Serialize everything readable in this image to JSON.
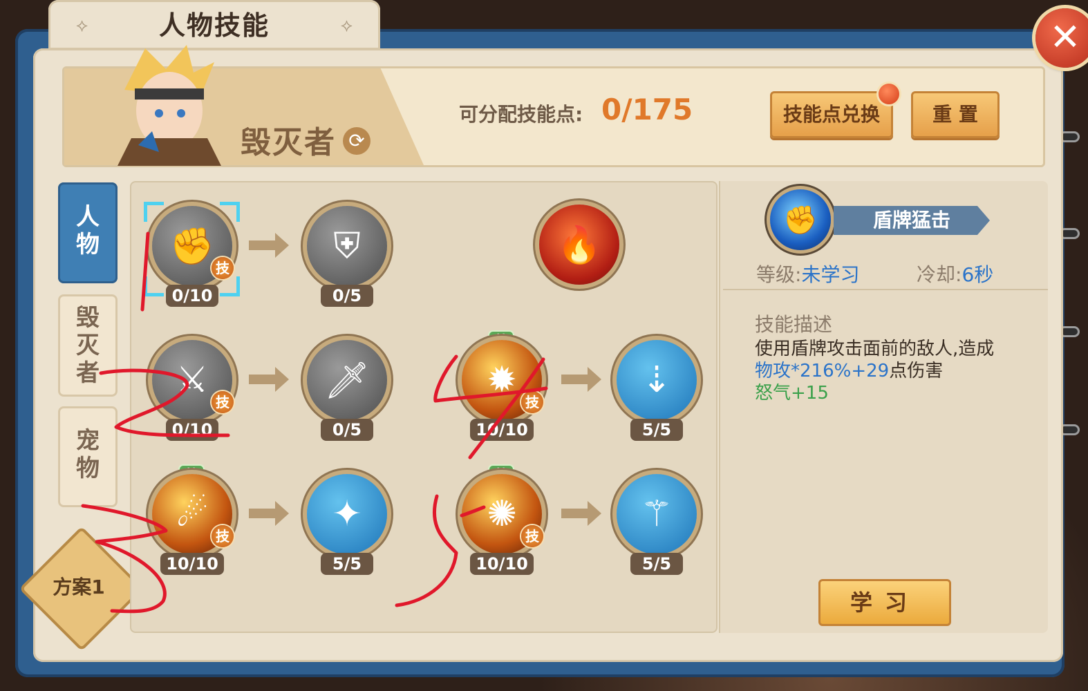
{
  "window": {
    "title": "人物技能"
  },
  "banner": {
    "class_name": "毁灭者",
    "points_label": "可分配技能点:",
    "points_value": "0/175",
    "exchange_button": "技能点兑换",
    "reset_button": "重  置"
  },
  "side_tabs": [
    {
      "label": [
        "人",
        "物"
      ],
      "active": true
    },
    {
      "label": [
        "毁",
        "灭",
        "者"
      ],
      "active": false
    },
    {
      "label": [
        "宠",
        "物"
      ],
      "active": false
    }
  ],
  "plan_badge": "方案1",
  "skill_tree": {
    "rows": [
      {
        "nodes": [
          {
            "icon": "fist-icon",
            "style": "gray",
            "level": "0/10",
            "ji": true,
            "selected": true
          },
          {
            "icon": "lightning-shield-icon",
            "style": "gray",
            "level": "0/5"
          },
          {
            "icon": "fire-warrior-icon",
            "style": "red",
            "level": ""
          }
        ]
      },
      {
        "nodes": [
          {
            "icon": "blade-slash-icon",
            "style": "gray",
            "level": "0/10",
            "ji": true
          },
          {
            "icon": "sword-icon",
            "style": "gray",
            "level": "0/5"
          },
          {
            "icon": "flame-burst-icon",
            "style": "fire",
            "level": "10/10",
            "ji": true,
            "equipped": true
          },
          {
            "icon": "sword-down-icon",
            "style": "blue",
            "level": "5/5"
          }
        ]
      },
      {
        "nodes": [
          {
            "icon": "fire-charge-icon",
            "style": "fire",
            "level": "10/10",
            "ji": true,
            "equipped": true
          },
          {
            "icon": "spinning-sword-icon",
            "style": "blue",
            "level": "5/5"
          },
          {
            "icon": "fire-strike-icon",
            "style": "fire",
            "level": "10/10",
            "ji": true,
            "equipped": true
          },
          {
            "icon": "sword-slash-icon",
            "style": "blue",
            "level": "5/5"
          }
        ]
      }
    ],
    "ji_label": "技",
    "equip_label": "装"
  },
  "info": {
    "skill_name": "盾牌猛击",
    "level_label": "等级:",
    "level_value": "未学习",
    "cooldown_label": "冷却:",
    "cooldown_value": "6秒",
    "desc_title": "技能描述",
    "desc_line1": "使用盾牌攻击面前的敌人,造成",
    "desc_line2_blue": "物攻*216%+29",
    "desc_line2_rest": "点伤害",
    "desc_line3": "怒气+15",
    "study_button": "学习"
  },
  "annotations": [
    "1",
    "2",
    "3",
    "4",
    "5"
  ],
  "colors": {
    "accent_orange": "#e0792a",
    "active_tab": "#3f7fb4",
    "value_blue": "#2a73c9",
    "rage_green": "#3aa04a",
    "annotation_red": "#e0182b"
  }
}
